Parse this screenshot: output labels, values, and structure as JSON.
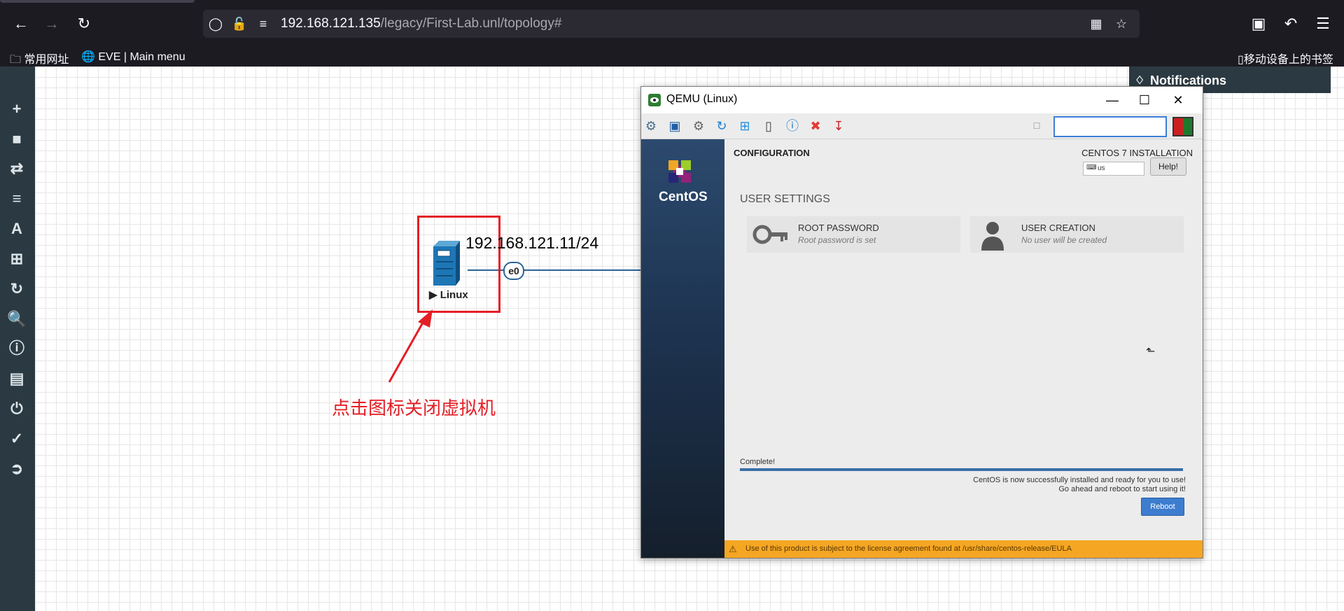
{
  "browser": {
    "url_host": "192.168.121.135",
    "url_path": "/legacy/First-Lab.unl/topology#",
    "bookmarks": [
      "常用网址",
      "EVE | Main menu"
    ],
    "mobile_bookmarks": "移动设备上的书签"
  },
  "notifications": {
    "title": "Notifications"
  },
  "topology": {
    "node_ip": "192.168.121.11/24",
    "node_name": "▶ Linux",
    "interface": "e0",
    "annotation": "点击图标关闭虚拟机",
    "annotation_color": "#e41e26"
  },
  "qemu": {
    "title": "QEMU (Linux)",
    "centos": {
      "brand": "CentOS",
      "configuration": "CONFIGURATION",
      "installation": "CENTOS 7 INSTALLATION",
      "keyboard": "us",
      "help": "Help!",
      "user_settings": "USER SETTINGS",
      "root_password_title": "ROOT PASSWORD",
      "root_password_status": "Root password is set",
      "user_creation_title": "USER CREATION",
      "user_creation_status": "No user will be created",
      "complete": "Complete!",
      "progress": 1.0,
      "done_line1": "CentOS is now successfully installed and ready for you to use!",
      "done_line2": "Go ahead and reboot to start using it!",
      "reboot": "Reboot",
      "eula": "Use of this product is subject to the license agreement found at /usr/share/centos-release/EULA"
    }
  }
}
